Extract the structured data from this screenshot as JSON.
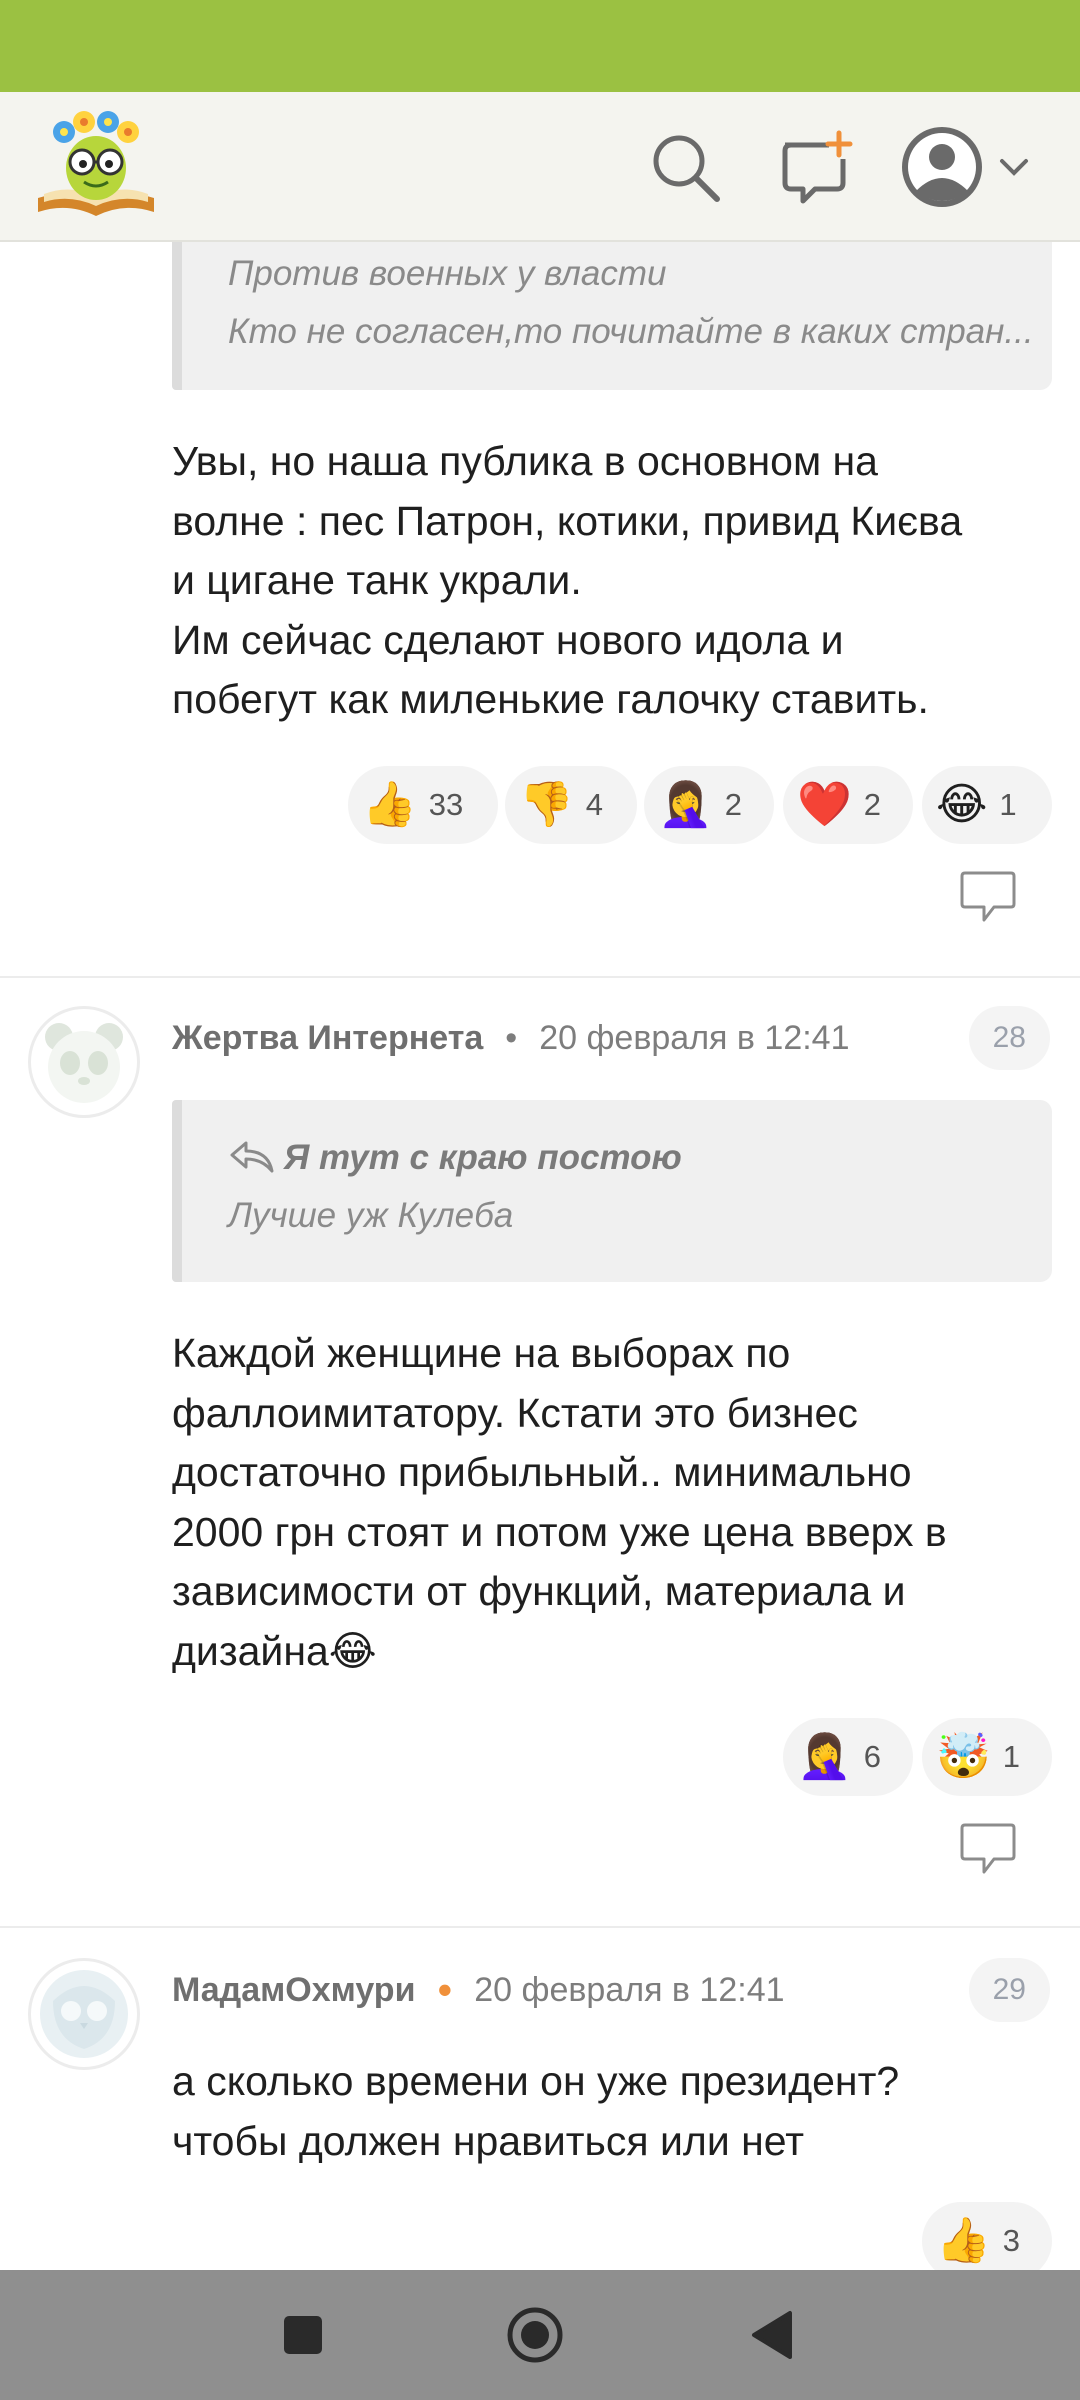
{
  "header": {
    "logo_icon": "smiley-book-logo-icon",
    "search_icon": "search-icon",
    "new_post_icon": "new-post-icon",
    "profile_icon": "user-avatar-icon",
    "menu_icon": "chevron-down-icon",
    "status_bar_color": "#9bc142"
  },
  "comments": [
    {
      "quote": {
        "lines": [
          "Против военных у власти",
          "Кто не согласен,то почитайте в каких стран..."
        ]
      },
      "body": [
        "Увы, но наша публика в основном на",
        "волне : пес Патрон, котики, привид Києва",
        "и цигане танк украли.",
        "Им сейчас сделают нового идола и",
        "побегут как миленькие галочку ставить."
      ],
      "reactions": [
        {
          "emoji": "👍",
          "count": "33"
        },
        {
          "emoji": "👎",
          "count": "4"
        },
        {
          "emoji": "🤦‍♀️",
          "count": "2"
        },
        {
          "emoji": "❤️",
          "count": "2"
        },
        {
          "emoji": "😂",
          "count": "1"
        }
      ]
    },
    {
      "author": "Жертва Интернета",
      "date": "20 февраля в 12:41",
      "number": "28",
      "quote": {
        "author": "Я тут с краю постою",
        "text": "Лучше уж Кулеба"
      },
      "body": [
        "Каждой женщине на выборах по",
        "фаллоимитатору. Кстати это бизнес",
        "достаточно прибыльный.. минимально",
        "2000 грн стоят и потом уже цена вверх в",
        "зависимости от функций, материала и",
        "дизайна😂"
      ],
      "reactions": [
        {
          "emoji": "🤦‍♀️",
          "count": "6"
        },
        {
          "emoji": "🤯",
          "count": "1"
        }
      ]
    },
    {
      "author": "МадамОхмури",
      "date": "20 февраля в 12:41",
      "number": "29",
      "body": [
        "а сколько времени он уже президент?",
        "чтобы должен нравиться или нет"
      ],
      "reactions": [
        {
          "emoji": "👍",
          "count": "3"
        }
      ]
    }
  ],
  "nav": {
    "recents_icon": "square-recents-icon",
    "home_icon": "circle-home-icon",
    "back_icon": "triangle-back-icon"
  }
}
